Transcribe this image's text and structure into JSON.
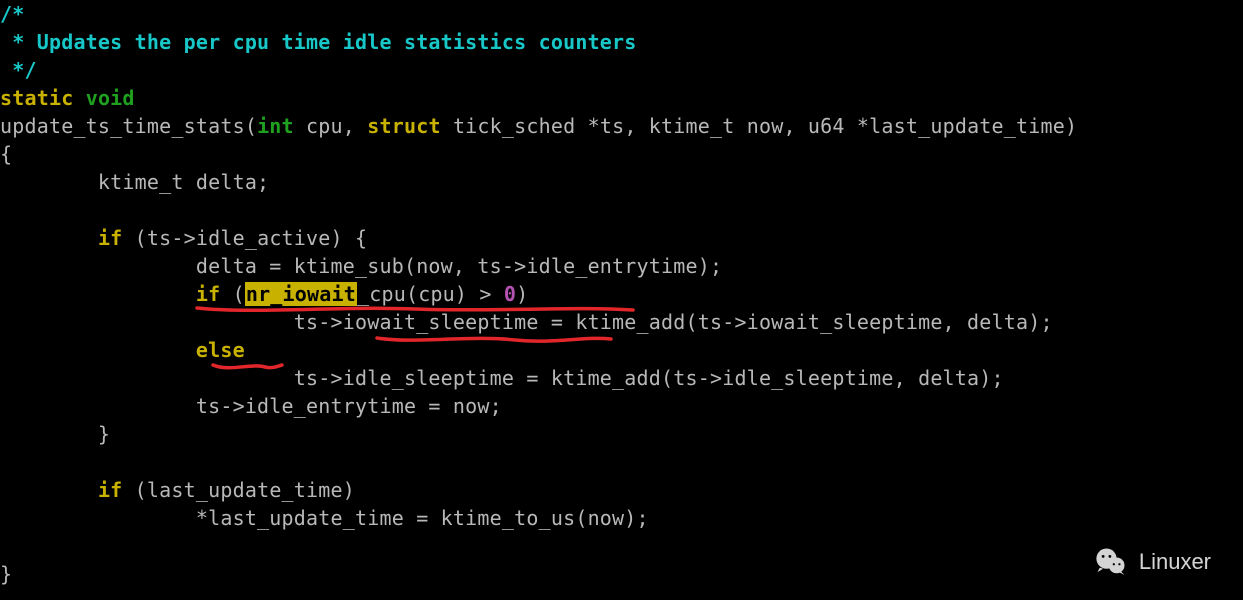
{
  "code": {
    "comment_open": "/*",
    "comment_body": " * Updates the per cpu time idle statistics counters",
    "comment_close": " */",
    "kw_static": "static",
    "kw_void": "void",
    "fn_sig_a": "update_ts_time_stats(",
    "kw_int": "int",
    "fn_sig_b": " cpu, ",
    "kw_struct": "struct",
    "fn_sig_c": " tick_sched *ts, ktime_t now, u64 *last_update_time)",
    "brace_open": "{",
    "decl": "        ktime_t delta;",
    "kw_if": "if",
    "if1_cond": " (ts->idle_active) {",
    "line_delta": "                delta = ktime_sub(now, ts->idle_entrytime);",
    "if2_open": " (",
    "hl_nr_iowait": "nr_iowait",
    "if2_rest_a": "_cpu(cpu) > ",
    "num_zero": "0",
    "if2_rest_b": ")",
    "line_iowait": "                        ts->iowait_sleeptime = ktime_add(ts->iowait_sleeptime, delta);",
    "kw_else": "else",
    "line_idle": "                        ts->idle_sleeptime = ktime_add(ts->idle_sleeptime, delta);",
    "line_entry": "                ts->idle_entrytime = now;",
    "inner_brace_close": "        }",
    "if3_cond": " (last_update_time)",
    "line_last": "                *last_update_time = ktime_to_us(now);",
    "brace_close": "}"
  },
  "watermark": {
    "text": "Linuxer"
  }
}
